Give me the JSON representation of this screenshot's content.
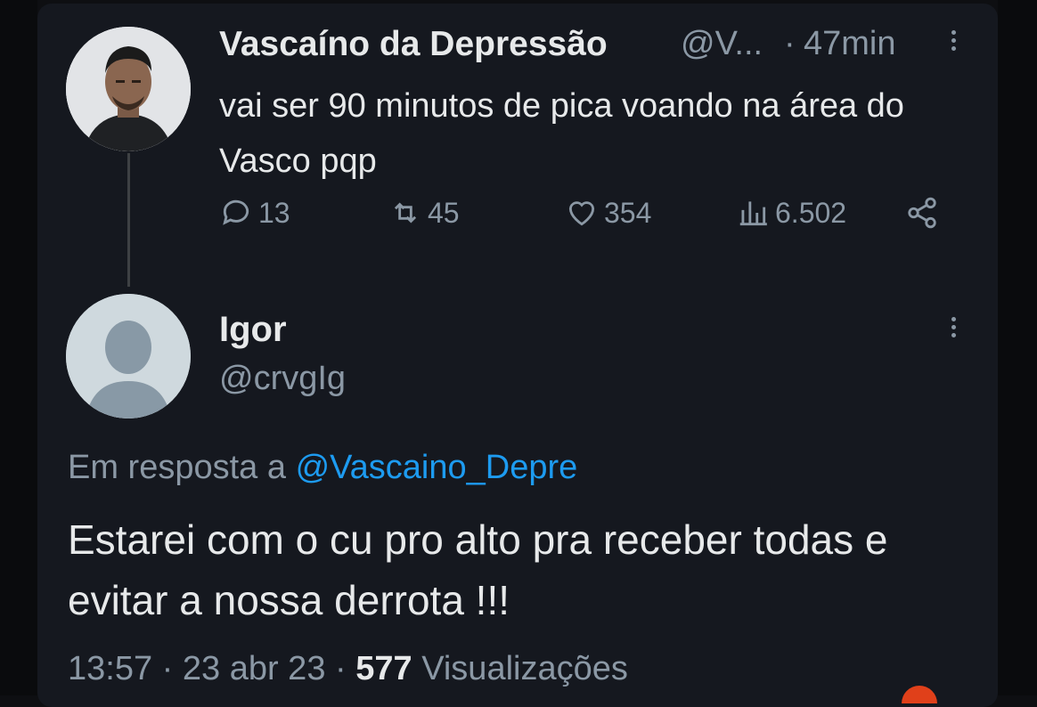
{
  "original_tweet": {
    "author_name": "Vascaíno da Depressão",
    "author_handle": "@V...",
    "separator": "·",
    "time_ago": "47min",
    "text": "vai ser 90 minutos de pica voando na área do Vasco pqp",
    "actions": {
      "replies": "13",
      "retweets": "45",
      "likes": "354",
      "views": "6.502"
    }
  },
  "reply_tweet": {
    "author_name": "Igor",
    "author_handle": "@crvgIg",
    "reply_prefix": "Em resposta a",
    "reply_mention": "@Vascaino_Depre",
    "text": "Estarei com o cu pro alto pra receber todas e evitar a nossa derrota !!!",
    "time": "13:57",
    "date": "23 abr 23",
    "views_count": "577",
    "views_label": "Visualizações",
    "separator": "·"
  },
  "colors": {
    "background": "#15181f",
    "text_primary": "#e7e9ea",
    "text_secondary": "#8b98a5",
    "accent": "#1d9bf0"
  },
  "icons": {
    "reply": "comment-icon",
    "retweet": "retweet-icon",
    "like": "heart-icon",
    "views": "bar-chart-icon",
    "share": "share-icon",
    "more": "more-options-icon"
  }
}
